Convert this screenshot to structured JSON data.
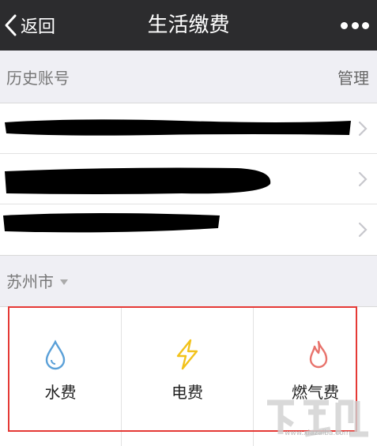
{
  "navbar": {
    "back_label": "返回",
    "title": "生活缴费",
    "more_icon": "more-horizontal-icon"
  },
  "history": {
    "header_label": "历史账号",
    "manage_label": "管理",
    "accounts_count": 3
  },
  "city": {
    "label": "苏州市"
  },
  "services": [
    {
      "label": "水费",
      "icon": "water-drop-icon",
      "color": "#5aa0d8"
    },
    {
      "label": "电费",
      "icon": "lightning-icon",
      "color": "#f2c21a"
    },
    {
      "label": "燃气费",
      "icon": "flame-icon",
      "color": "#e8736c"
    }
  ],
  "colors": {
    "navbar_bg": "#2c2c2e",
    "highlight_border": "#e53935",
    "page_bg": "#efeff4"
  },
  "watermark": {
    "site": "www.xiazaiba.com"
  }
}
